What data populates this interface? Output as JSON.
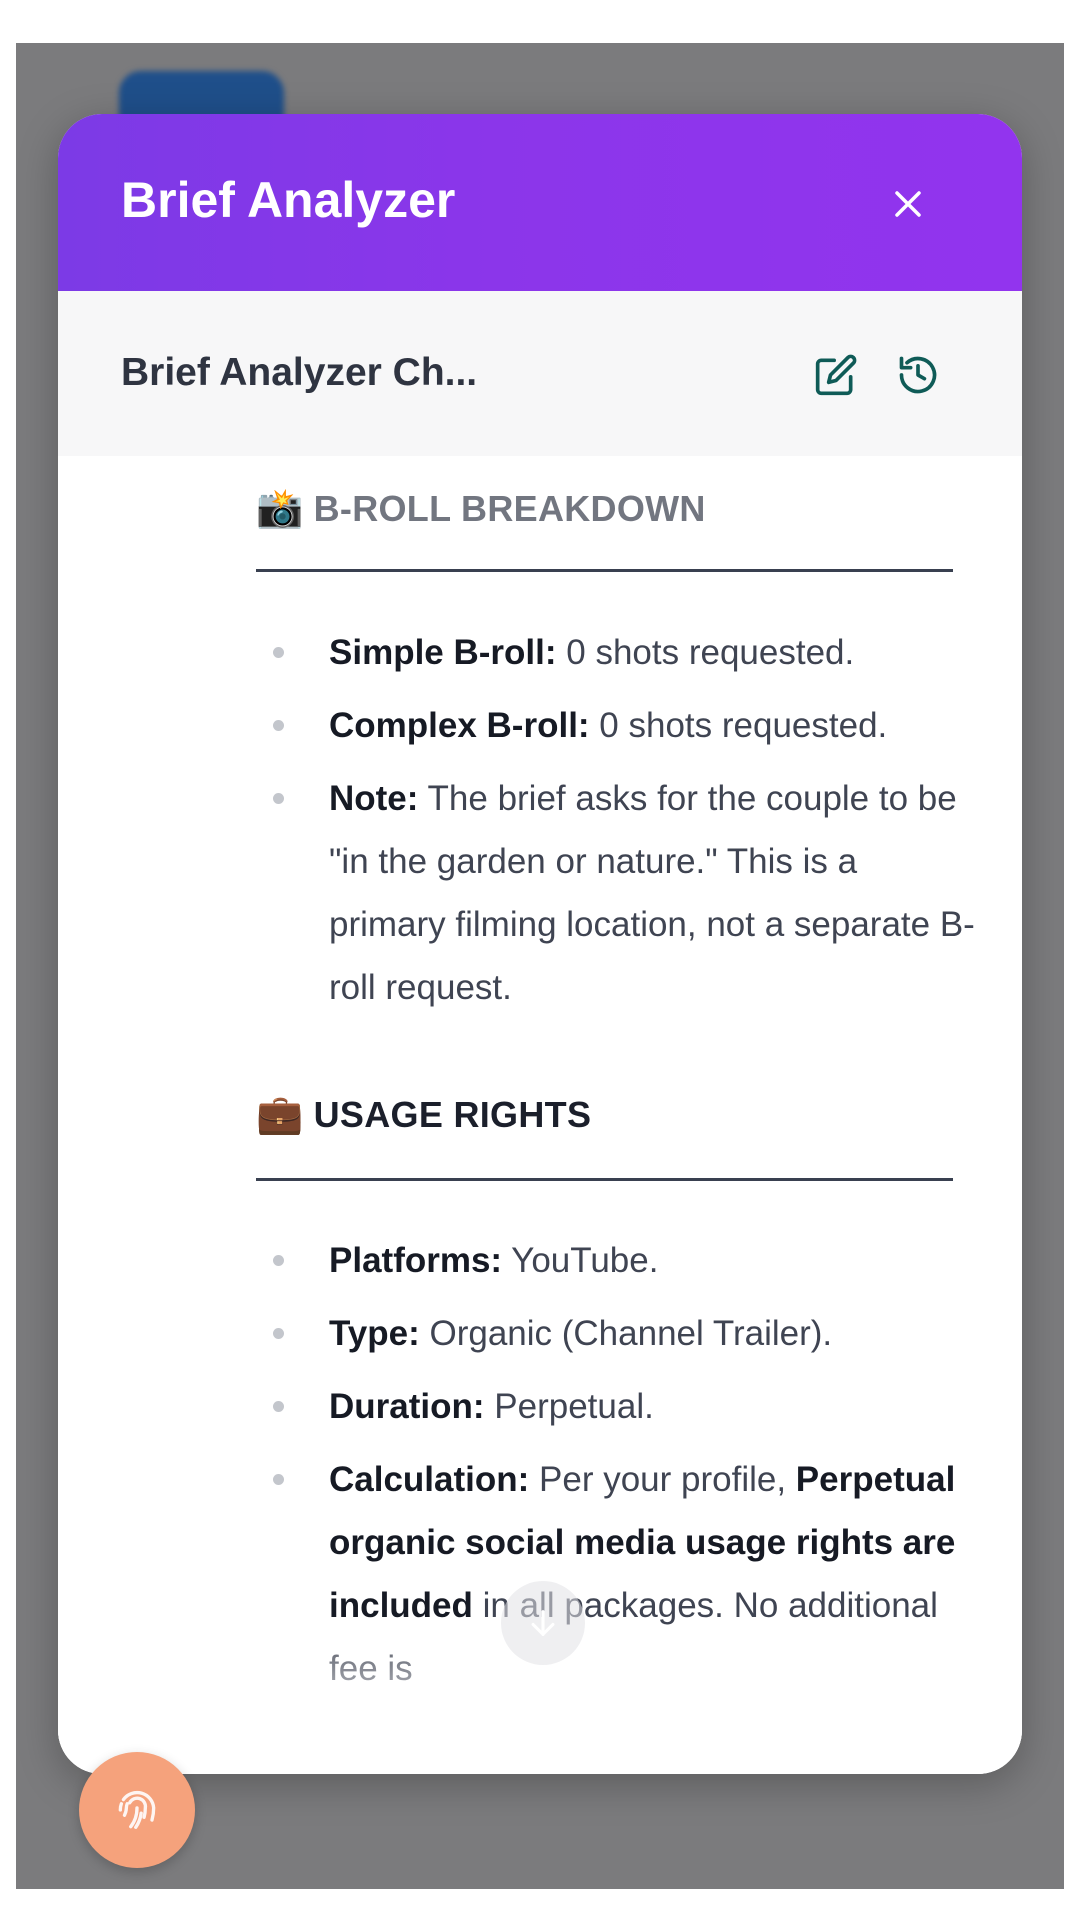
{
  "modal": {
    "title": "Brief Analyzer",
    "subtitle": "Brief Analyzer Ch..."
  },
  "icons": {
    "close": "close-icon",
    "edit": "edit-icon",
    "history": "history-icon",
    "scroll_down": "arrow-down-icon",
    "fab": "fingerprint-icon"
  },
  "sections": [
    {
      "emoji": "📸",
      "heading": "B-ROLL BREAKDOWN",
      "items": [
        {
          "label": "Simple B-roll:",
          "text": " 0 shots requested."
        },
        {
          "label": "Complex B-roll:",
          "text": " 0 shots requested."
        },
        {
          "label": "Note:",
          "text": " The brief asks for the couple to be \"in the garden or nature.\" This is a primary filming location, not a separate B-roll request."
        }
      ]
    },
    {
      "emoji": "💼",
      "heading": "USAGE RIGHTS",
      "items": [
        {
          "label": "Platforms:",
          "text": " YouTube."
        },
        {
          "label": "Type:",
          "text": " Organic (Channel Trailer)."
        },
        {
          "label": "Duration:",
          "text": " Perpetual."
        },
        {
          "label": "Calculation:",
          "text": " Per your profile, ",
          "bold2": "Perpetual organic social media usage rights are included",
          "text2": " in all packages. No additional fee is"
        }
      ]
    }
  ],
  "colors": {
    "header_start": "#7c3ae6",
    "header_end": "#9234ee",
    "fab": "#f5a27c",
    "backdrop": "#7b7b7d"
  }
}
